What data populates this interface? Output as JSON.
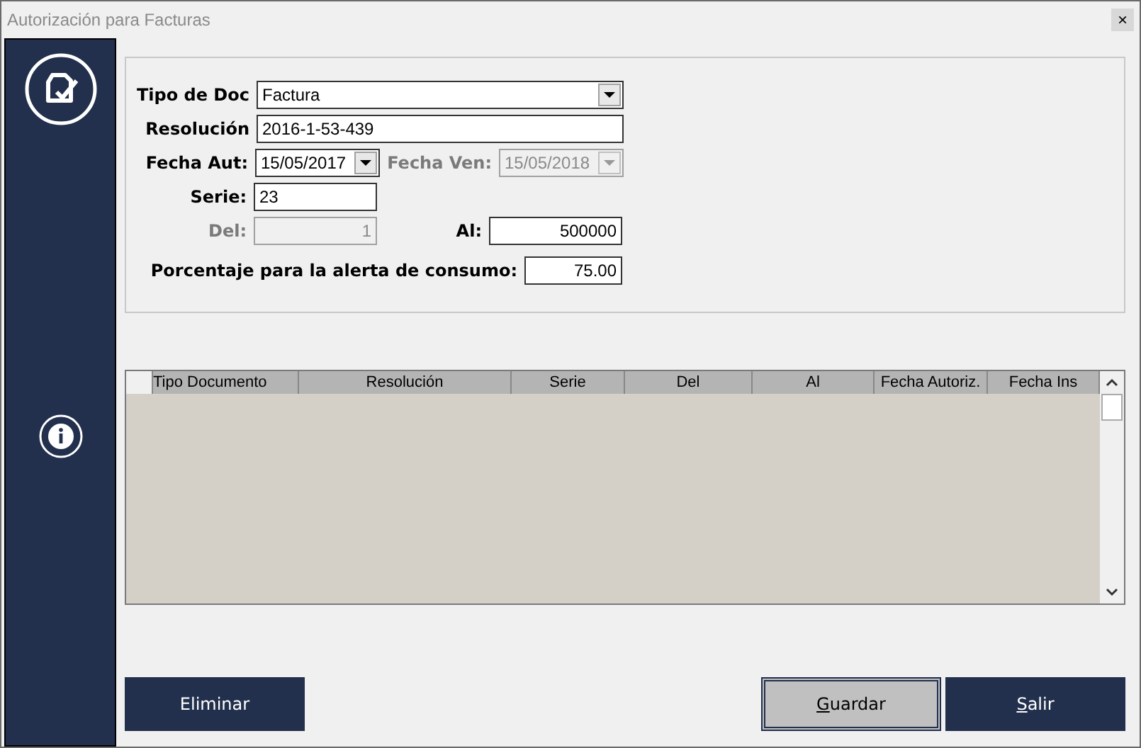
{
  "window": {
    "title": "Autorización para Facturas",
    "close": "×"
  },
  "form": {
    "fields": [
      {
        "kind": "select",
        "label": "Tipo de Doc",
        "value": "Factura",
        "disabled": false
      },
      {
        "kind": "text",
        "label": "Resolución",
        "value": "2016-1-53-439",
        "disabled": false
      },
      {
        "kind": "date",
        "label": "Fecha Aut:",
        "value": "15/05/2017",
        "disabled": false
      },
      {
        "kind": "date",
        "label": "Fecha Ven:",
        "value": "15/05/2018",
        "disabled": true
      },
      {
        "kind": "text",
        "label": "Serie:",
        "value": "23",
        "disabled": false
      },
      {
        "kind": "number",
        "label": "Del:",
        "value": "1",
        "disabled": true
      },
      {
        "kind": "number",
        "label": "Al:",
        "value": "500000",
        "disabled": false
      },
      {
        "kind": "number",
        "label": "Porcentaje para la alerta de consumo:",
        "value": "75.00",
        "disabled": false
      }
    ]
  },
  "table": {
    "columns": [
      "Tipo Documento",
      "Resolución",
      "Serie",
      "Del",
      "Al",
      "Fecha Autoriz.",
      "Fecha Ins"
    ]
  },
  "buttons": [
    {
      "label": "Eliminar",
      "default": false,
      "underline_first": false
    },
    {
      "label": "Guardar",
      "default": true,
      "underline_first": true
    },
    {
      "label": "Salir",
      "default": false,
      "underline_first": true
    }
  ]
}
